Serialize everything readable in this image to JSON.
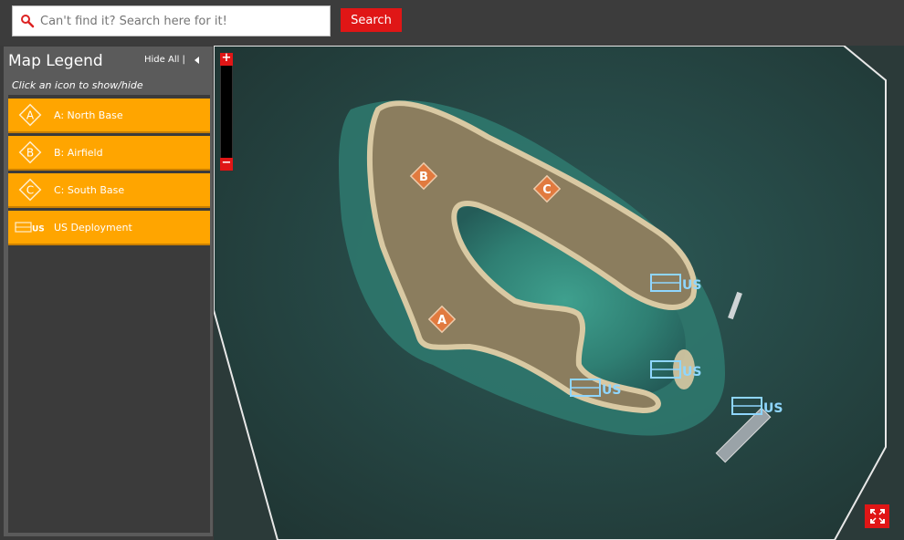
{
  "search": {
    "placeholder": "Can't find it? Search here for it!",
    "button_label": "Search"
  },
  "legend": {
    "title": "Map Legend",
    "hide_all_label": "Hide All |",
    "hint": "Click an icon to show/hide",
    "items": [
      {
        "icon": "A",
        "label": "A: North Base"
      },
      {
        "icon": "B",
        "label": "B: Airfield"
      },
      {
        "icon": "C",
        "label": "C: South Base"
      },
      {
        "icon": "US",
        "label": "US Deployment"
      }
    ]
  },
  "map": {
    "zoom_in_label": "+",
    "zoom_out_label": "−",
    "markers": {
      "a": "A",
      "b": "B",
      "c": "C",
      "us": "US"
    }
  },
  "colors": {
    "accent_red": "#e01616",
    "legend_orange": "#ffa500",
    "marker_orange": "#f07a3a",
    "us_blue": "#8fd6ff"
  }
}
